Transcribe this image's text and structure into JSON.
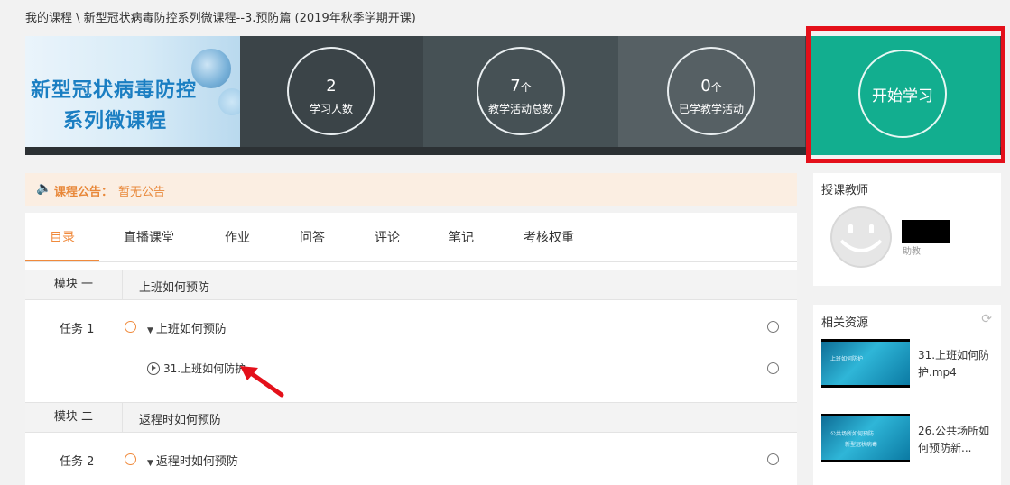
{
  "breadcrumb": "我的课程 \\ 新型冠状病毒防控系列微课程--3.预防篇 (2019年秋季学期开课)",
  "banner": {
    "line1": "新型冠状病毒防控",
    "line2": "系列微课程"
  },
  "stats": [
    {
      "value": "2",
      "unit": "",
      "label": "学习人数"
    },
    {
      "value": "7",
      "unit": "个",
      "label": "教学活动总数"
    },
    {
      "value": "0",
      "unit": "个",
      "label": "已学教学活动"
    }
  ],
  "start_button": "开始学习",
  "notice": {
    "label": "课程公告：",
    "value": "暂无公告"
  },
  "tabs": [
    "目录",
    "直播课堂",
    "作业",
    "问答",
    "评论",
    "笔记",
    "考核权重"
  ],
  "modules": [
    {
      "label": "模块 一",
      "title": "上班如何预防",
      "tasks": [
        {
          "label": "任务 1",
          "title": "上班如何预防",
          "resources": [
            "31.上班如何防护"
          ]
        }
      ]
    },
    {
      "label": "模块 二",
      "title": "返程时如何预防",
      "tasks": [
        {
          "label": "任务 2",
          "title": "返程时如何预防",
          "resources": []
        }
      ]
    }
  ],
  "teacher_panel": {
    "title": "授课教师",
    "role": "助教"
  },
  "related_panel": {
    "title": "相关资源",
    "items": [
      {
        "name": "31.上班如何防护.mp4",
        "thumb_text": [
          "上班如何防护",
          ""
        ]
      },
      {
        "name": "26.公共场所如何预防新...",
        "thumb_text": [
          "公共场所如何预防",
          "新型冠状病毒"
        ]
      }
    ]
  },
  "colors": {
    "accent": "#12ae8f",
    "highlight": "#e4101a",
    "tab_active": "#f08a3c"
  }
}
